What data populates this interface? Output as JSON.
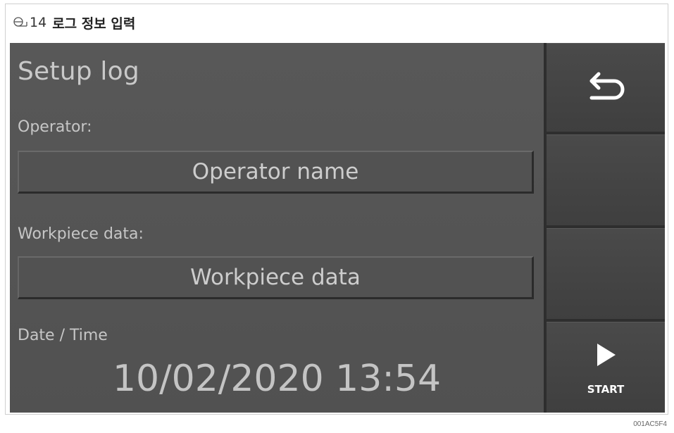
{
  "caption": {
    "figure_number": "14",
    "title": "로그 정보 입력"
  },
  "screen": {
    "title": "Setup log",
    "operator_label": "Operator:",
    "operator_value": "Operator name",
    "workpiece_label": "Workpiece data:",
    "workpiece_value": "Workpiece data",
    "datetime_label": "Date / Time",
    "datetime_value": "10/02/2020 13:54"
  },
  "side_buttons": {
    "back_icon": "back-arrow-icon",
    "start_icon": "play-icon",
    "start_label": "START"
  },
  "reference_code": "001AC5F4"
}
